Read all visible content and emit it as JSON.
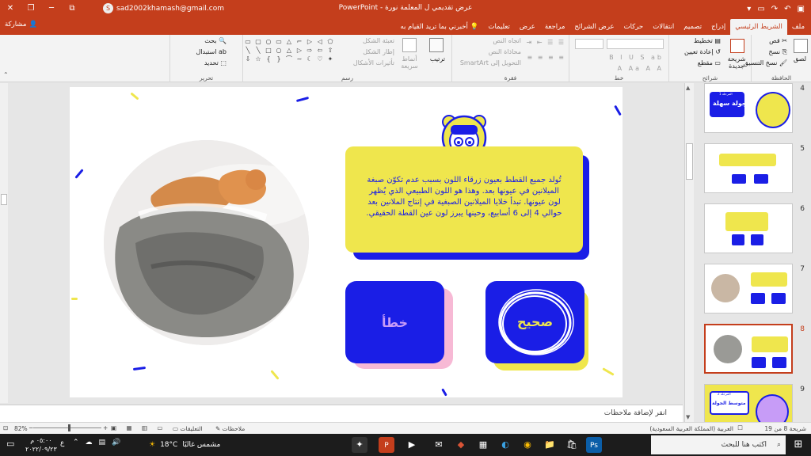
{
  "titlebar": {
    "title": "عرض تقديمي ل المعلمة نورة - PowerPoint",
    "user_email": "sad2002khamash@gmail.com",
    "avatar_letter": "S"
  },
  "tabs": [
    "ملف",
    "الشريط الرئيسي",
    "إدراج",
    "تصميم",
    "انتقالات",
    "حركات",
    "عرض الشرائح",
    "مراجعة",
    "عرض",
    "تعليمات"
  ],
  "active_tab": "الشريط الرئيسي",
  "tell_me": "أخبرني بما تريد القيام به",
  "share_label": "مشاركة",
  "ribbon": {
    "clipboard": {
      "label": "الحافظة",
      "paste": "لصق",
      "cut": "قص",
      "copy": "نسخ",
      "format_painter": "نسخ التنسيق"
    },
    "slides": {
      "label": "شرائح",
      "new_slide": "شريحة جديدة",
      "layout": "تخطيط",
      "reset": "إعادة تعيين",
      "section": "مقطع"
    },
    "font": {
      "label": "خط"
    },
    "paragraph": {
      "label": "فقرة",
      "text_direction": "اتجاه النص",
      "align_text": "محاذاة النص",
      "smartart": "التحويل إلى SmartArt"
    },
    "drawing": {
      "label": "رسم",
      "arrange": "ترتيب",
      "quick_styles": "أنماط سريعة",
      "shape_fill": "تعبئة الشكل",
      "shape_outline": "إطار الشكل",
      "shape_effects": "تأثيرات الأشكال"
    },
    "editing": {
      "label": "تحرير",
      "find": "بحث",
      "replace": "استبدال",
      "select": "تحديد"
    }
  },
  "slide": {
    "text": "تُولد جميع القطط بعيون زرقاء اللون بسبب عدم تكوّن صبغة الميلانين في عيونها بعد. وهذا هو اللون الطبيعي الذي يُظهر لون عيونها. تبدأ خلايا الميلانين الصبغية في إنتاج الملانين بعد حوالي 4 إلى 6 أسابيع، وحينها يبرز لون عين القطة الحقيقي.",
    "true_label": "صحيح",
    "false_label": "خطأ",
    "colors": {
      "yellow": "#efe64d",
      "blue": "#1a1ee6",
      "pink": "#f7b9d5",
      "purple_text": "#c79cf7"
    }
  },
  "notes_placeholder": "انقر لإضافة ملاحظات",
  "thumbnails": [
    {
      "num": "4",
      "title": "جولة سهلة",
      "badge": "المرحلة 1"
    },
    {
      "num": "5",
      "title": "",
      "badge": ""
    },
    {
      "num": "6",
      "title": "",
      "badge": ""
    },
    {
      "num": "7",
      "title": "",
      "badge": ""
    },
    {
      "num": "8",
      "title": "",
      "badge": ""
    },
    {
      "num": "9",
      "title": "متوسط الجولة",
      "badge": "المرحلة 2"
    }
  ],
  "selected_thumbnail": "8",
  "status": {
    "slide_info": "شريحة 8 من 19",
    "language": "العربية (المملكة العربية السعودية)",
    "notes": "ملاحظات",
    "comments": "التعليقات",
    "zoom": "82%"
  },
  "taskbar": {
    "search": "اكتب هنا للبحث",
    "weather_temp": "18°C",
    "weather_text": "مشمس غالبًا",
    "time": "٠٥:٠٠ م",
    "date": "٢٠٢٢/٠٩/٢٣",
    "lang": "ع"
  }
}
